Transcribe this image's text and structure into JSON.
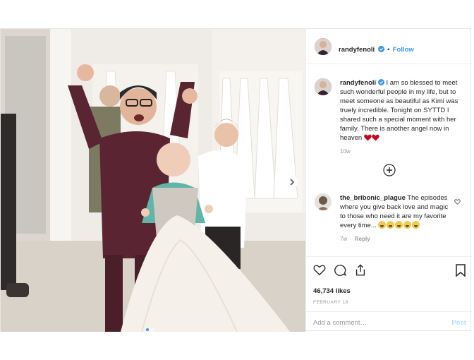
{
  "post": {
    "author": "randyfenoli",
    "follow_label": "Follow",
    "dot": "•",
    "caption": "I am so blessed to meet such wonderful people in my life, but to meet someone as beautiful as Kimi was truely incredible. Tonight on SYTTD I shared such a special moment with her family. There is another angel now in heaven",
    "caption_time": "10w",
    "comment": {
      "user": "the_bribonic_plague",
      "text": "The episodes where you give back love and magic to those who need it are my favorite every time...",
      "time": "7w",
      "reply_label": "Reply"
    },
    "likes": "46,734 likes",
    "date": "FEBRUARY 18",
    "add_comment_placeholder": "Add a comment…",
    "post_button": "Post"
  },
  "colors": {
    "accent": "#3897f0",
    "heart": "#d0021b",
    "muted": "#999999"
  },
  "icons": [
    "verified-badge-icon",
    "next-photo-icon",
    "load-more-icon",
    "like-heart-icon",
    "comment-icon",
    "share-icon",
    "save-bookmark-icon",
    "comment-like-icon",
    "red-heart-emoji-icon",
    "crying-emoji-icon"
  ]
}
